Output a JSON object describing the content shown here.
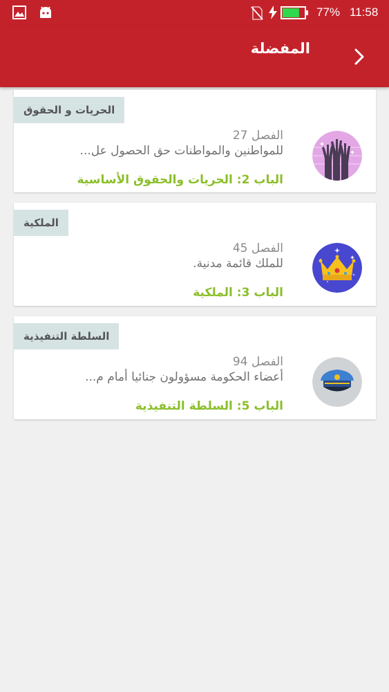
{
  "status_bar": {
    "battery_percent": "77%",
    "time": "11:58",
    "battery_level": 0.77
  },
  "app_bar": {
    "title": "المفضلة",
    "back_icon": "chevron-icon"
  },
  "favorites": [
    {
      "tag": "الحريات و الحقوق",
      "chapter": "الفصل 27",
      "excerpt": "للمواطنين والمواطنات حق الحصول عل...",
      "section": "الباب 2: الحريات والحقوق الأساسية",
      "icon": "raised-hands-icon"
    },
    {
      "tag": "الملكية",
      "chapter": "الفصل 45",
      "excerpt": "للملك قائمة مدنية.",
      "section": "الباب 3: الملكية",
      "icon": "crown-icon"
    },
    {
      "tag": "السلطة التنفيذية",
      "chapter": "الفصل 94",
      "excerpt": "أعضاء الحكومة مسؤولون جنائيا أمام م...",
      "section": "الباب 5: السلطة التنفيذية",
      "icon": "police-cap-icon"
    }
  ],
  "colors": {
    "primary": "#c4222b",
    "section_text": "#8bbf2a",
    "tag_background": "#d5e3e3"
  }
}
